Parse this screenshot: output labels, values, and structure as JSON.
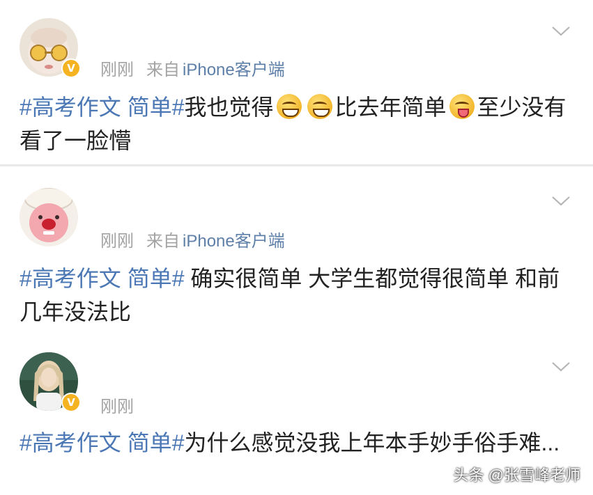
{
  "posts": [
    {
      "time": "刚刚",
      "from_prefix": "来自",
      "source": "iPhone客户端",
      "verified": true,
      "topic": "#高考作文 简单#",
      "text_a": "我也觉得",
      "text_b": "比去年简单",
      "text_c": "至少没有看了一脸懵"
    },
    {
      "time": "刚刚",
      "from_prefix": "来自",
      "source": "iPhone客户端",
      "verified": false,
      "topic": "#高考作文 简单#",
      "text": " 确实很简单 大学生都觉得很简单 和前几年没法比"
    },
    {
      "time": "刚刚",
      "verified": true,
      "topic": "#高考作文 简单#",
      "text": "为什么感觉没我上年本手妙手俗手难..."
    }
  ],
  "watermark": "头条 @张雪峰老师",
  "colors": {
    "topic": "#4b78b5",
    "source": "#5e7fa8",
    "meta": "#a3a3a3",
    "badge": "#f5b321"
  }
}
